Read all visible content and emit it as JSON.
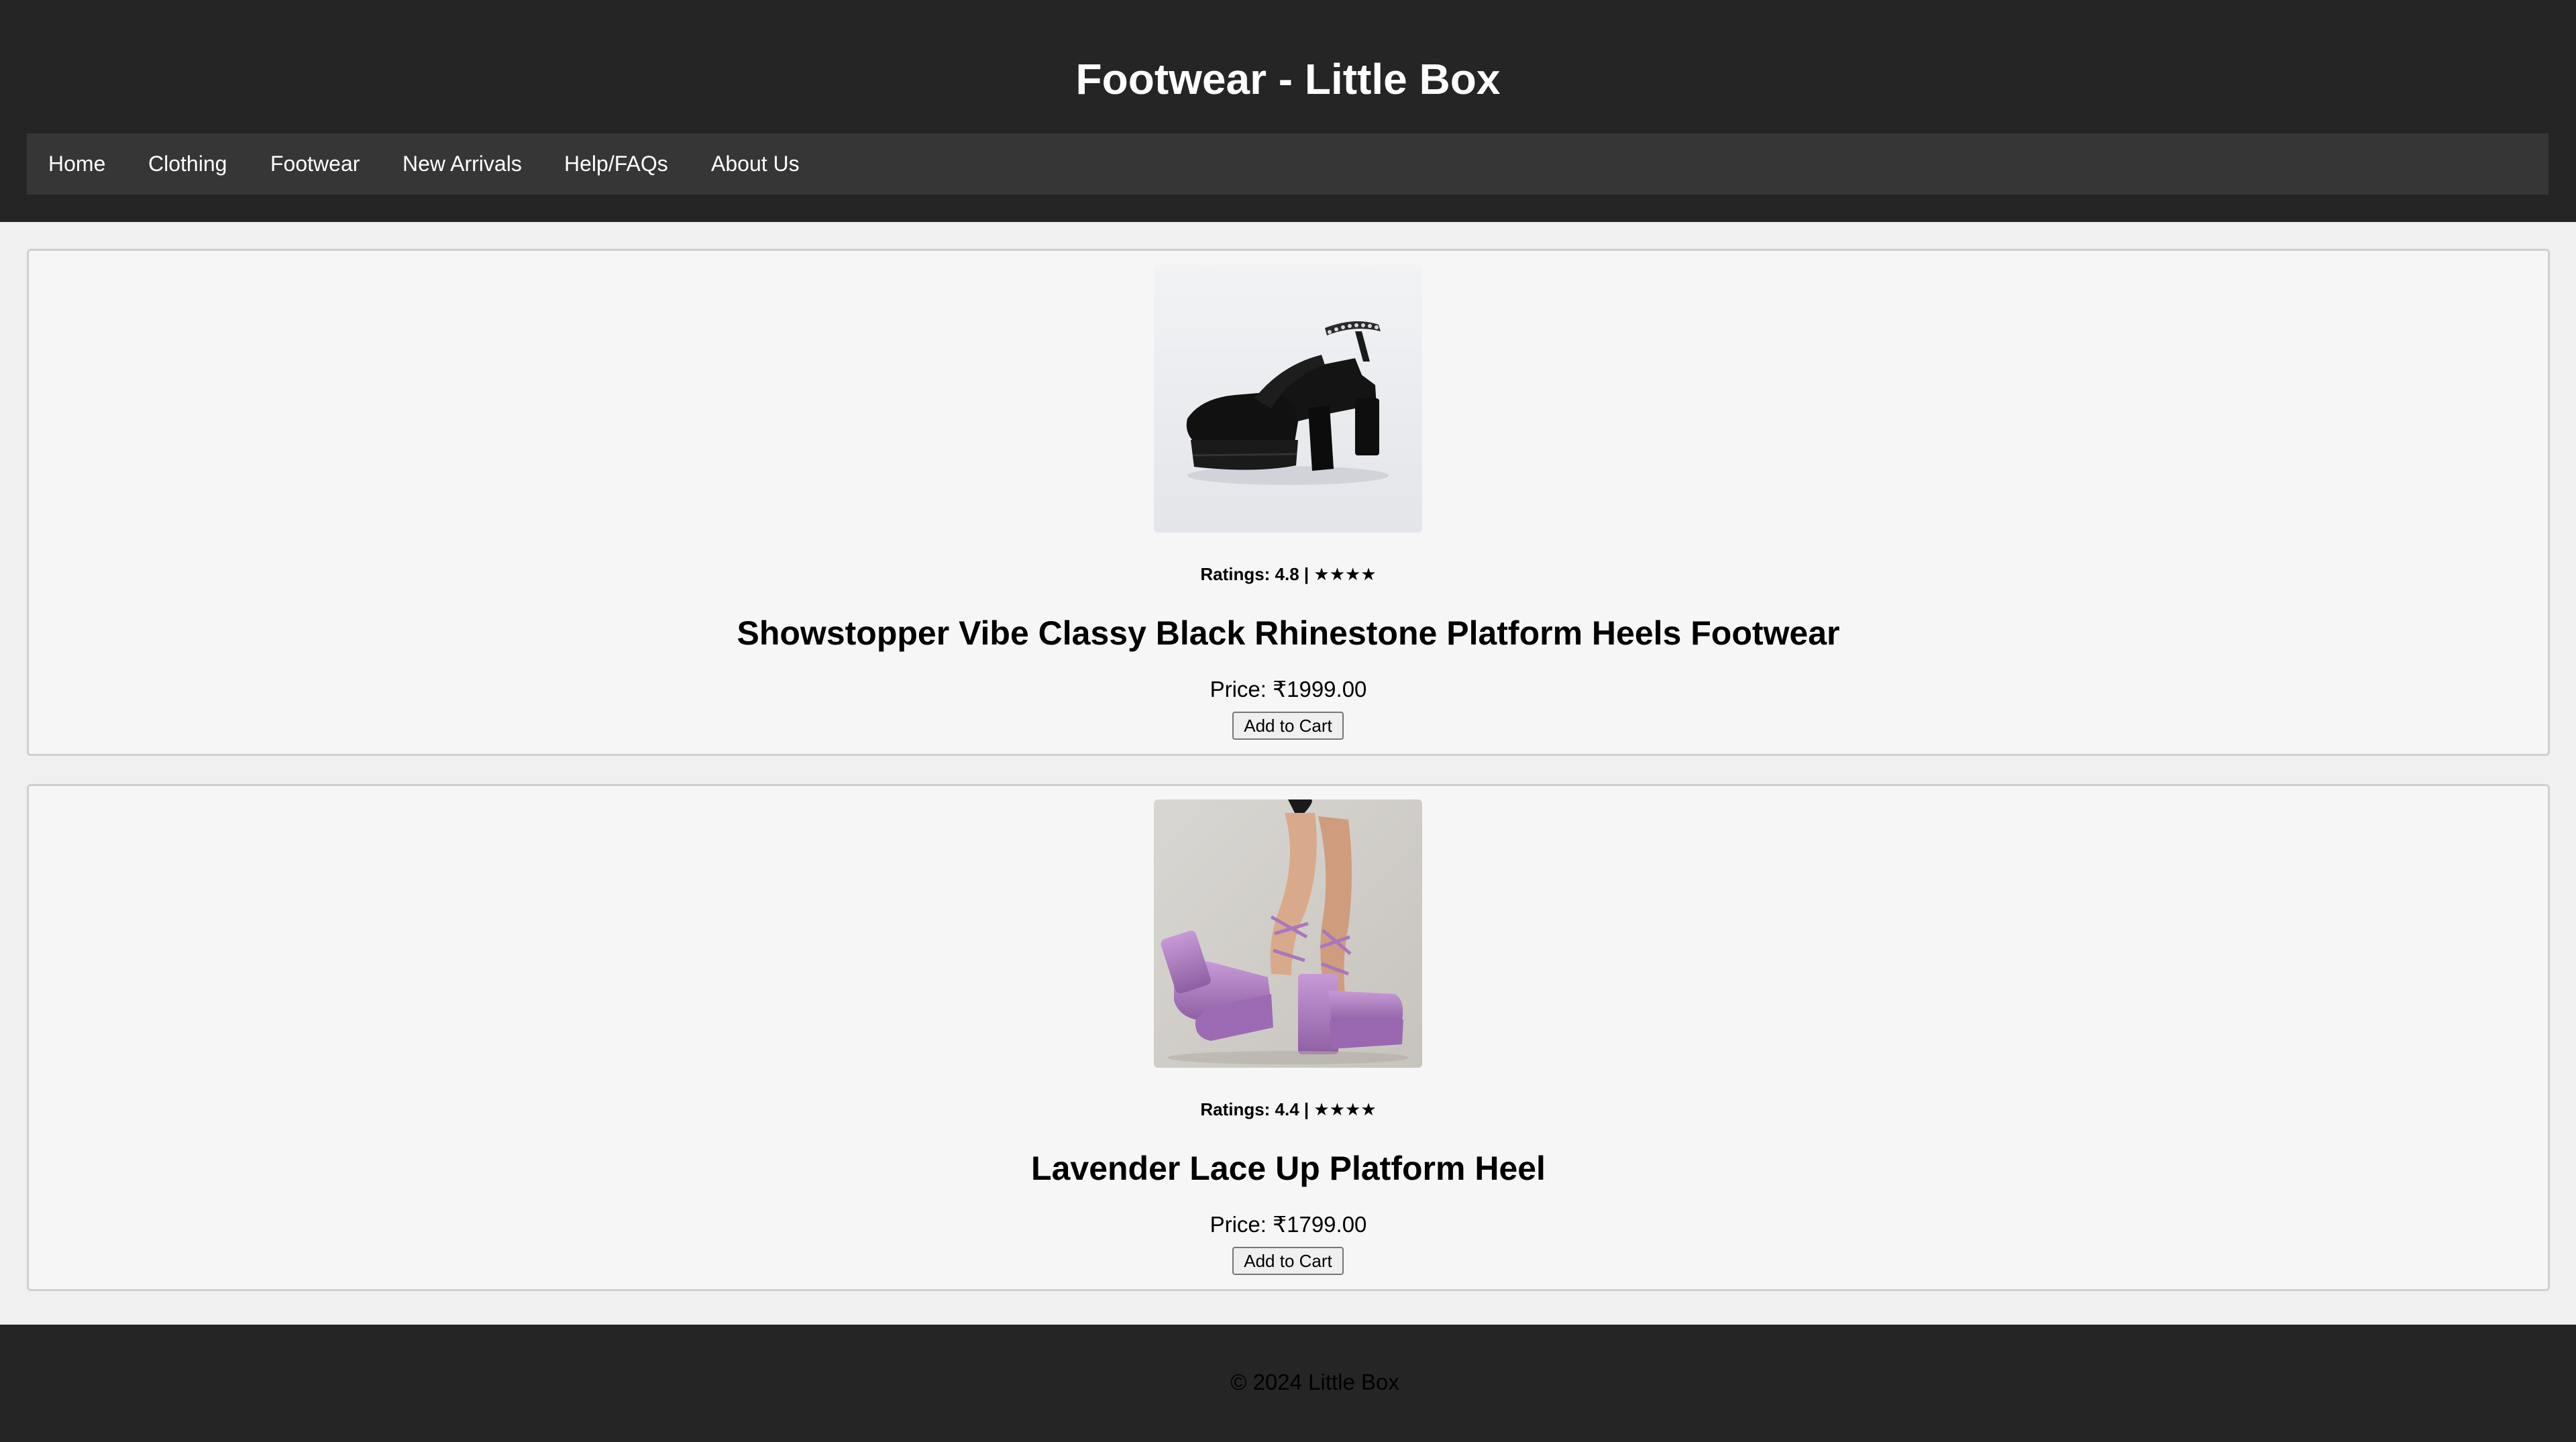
{
  "header": {
    "title": "Footwear - Little Box"
  },
  "nav": {
    "items": [
      {
        "label": "Home"
      },
      {
        "label": "Clothing"
      },
      {
        "label": "Footwear"
      },
      {
        "label": "New Arrivals"
      },
      {
        "label": "Help/FAQs"
      },
      {
        "label": "About Us"
      }
    ]
  },
  "products": [
    {
      "image": "black-platform-heels-photo",
      "rating": "Ratings: 4.8 | ★★★★",
      "title": "Showstopper Vibe Classy Black Rhinestone Platform Heels Footwear",
      "price": "Price: ₹1999.00",
      "button_label": "Add to Cart"
    },
    {
      "image": "lavender-lace-up-heels-photo",
      "rating": "Ratings: 4.4 | ★★★★",
      "title": "Lavender Lace Up Platform Heel",
      "price": "Price: ₹1799.00",
      "button_label": "Add to Cart"
    }
  ],
  "footer": {
    "text": "© 2024 Little Box"
  },
  "colors": {
    "header_bg": "#252525",
    "nav_bg": "#363636",
    "page_bg": "#f0f0f0",
    "card_bg": "#f6f6f6"
  }
}
